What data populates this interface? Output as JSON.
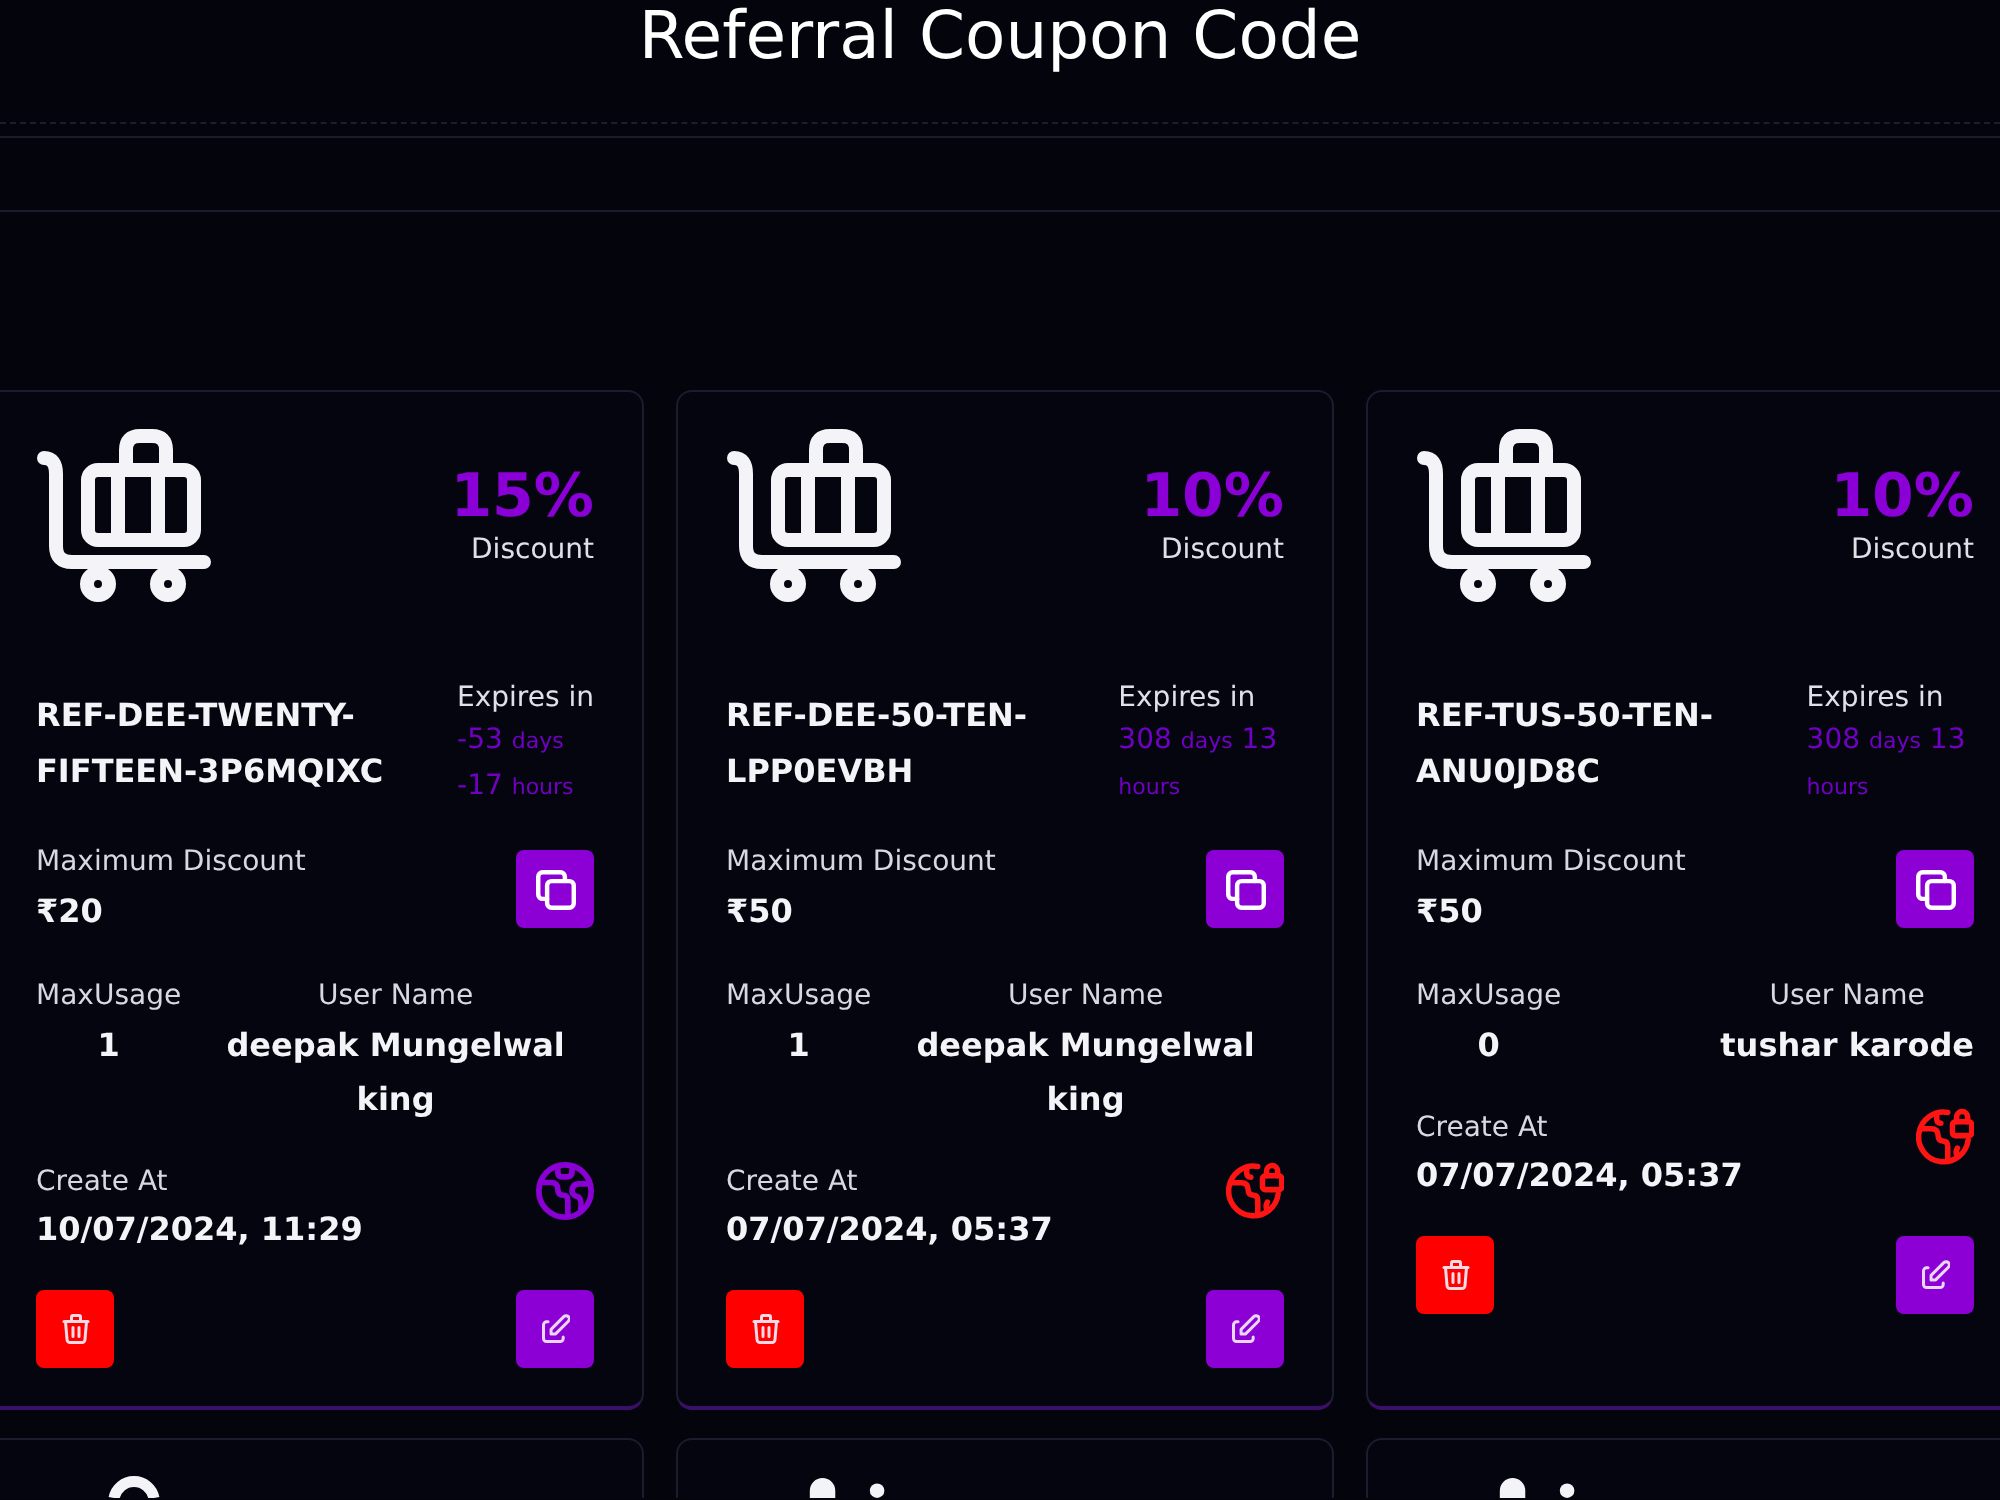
{
  "page": {
    "title": "Referral Coupon Code"
  },
  "coupons": [
    {
      "discount_percent": "15%",
      "discount_label": "Discount",
      "code": "REF-DEE-TWENTY-FIFTEEN-3P6MQIXC",
      "expires_label": "Expires in",
      "expires": [
        {
          "value": "-53",
          "unit": "days"
        },
        {
          "value": "-17",
          "unit": "hours"
        }
      ],
      "max_discount_label": "Maximum Discount",
      "max_discount": "₹20",
      "max_usage_label": "MaxUsage",
      "max_usage": "1",
      "user_name_label": "User Name",
      "user_name": "deepak Mungelwal king",
      "created_label": "Create At",
      "created_at": "10/07/2024, 11:29",
      "locked": false
    },
    {
      "discount_percent": "10%",
      "discount_label": "Discount",
      "code": "REF-DEE-50-TEN-LPP0EVBH",
      "expires_label": "Expires in",
      "expires": [
        {
          "value": "308",
          "unit": "days"
        },
        {
          "value": "13",
          "unit": "hours"
        }
      ],
      "max_discount_label": "Maximum Discount",
      "max_discount": "₹50",
      "max_usage_label": "MaxUsage",
      "max_usage": "1",
      "user_name_label": "User Name",
      "user_name": "deepak Mungelwal king",
      "created_label": "Create At",
      "created_at": "07/07/2024, 05:37",
      "locked": true
    },
    {
      "discount_percent": "10%",
      "discount_label": "Discount",
      "code": "REF-TUS-50-TEN-ANU0JD8C",
      "expires_label": "Expires in",
      "expires": [
        {
          "value": "308",
          "unit": "days"
        },
        {
          "value": "13",
          "unit": "hours"
        }
      ],
      "max_discount_label": "Maximum Discount",
      "max_discount": "₹50",
      "max_usage_label": "MaxUsage",
      "max_usage": "0",
      "user_name_label": "User Name",
      "user_name": "tushar karode",
      "created_label": "Create At",
      "created_at": "07/07/2024, 05:37",
      "locked": true
    }
  ],
  "more_coupons": [
    {
      "kind": "ring"
    },
    {
      "kind": "pill"
    },
    {
      "kind": "pill"
    }
  ]
}
